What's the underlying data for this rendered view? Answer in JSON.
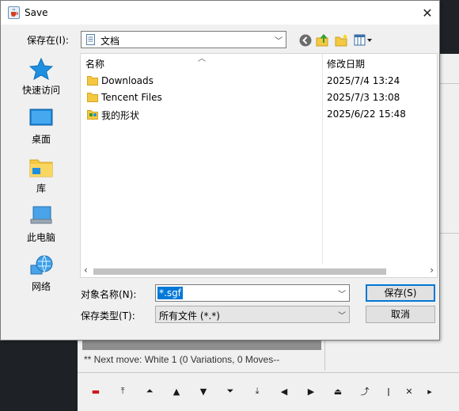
{
  "background_app": {
    "status_text": "** Next move: White 1 (0 Variations, 0 Moves--",
    "nav_buttons": [
      {
        "name": "toggle-icon",
        "glyph": "▬"
      },
      {
        "name": "goto-start-icon",
        "glyph": "⤒"
      },
      {
        "name": "fast-back-variation-icon",
        "glyph": "⏶"
      },
      {
        "name": "back-variation-icon",
        "glyph": "▲"
      },
      {
        "name": "next-variation-icon",
        "glyph": "▼"
      },
      {
        "name": "fast-next-variation-icon",
        "glyph": "⏷"
      },
      {
        "name": "goto-end-variation-icon",
        "glyph": "⤓"
      },
      {
        "name": "prev-move-icon",
        "glyph": "◀"
      },
      {
        "name": "next-move-icon",
        "glyph": "▶"
      },
      {
        "name": "goto-main-icon",
        "glyph": "⏏"
      },
      {
        "name": "goto-line-icon",
        "glyph": "⤴"
      },
      {
        "name": "marker-icon",
        "glyph": "ǀ"
      },
      {
        "name": "delete-icon",
        "glyph": "✕"
      },
      {
        "name": "more-icon",
        "glyph": "▸"
      }
    ]
  },
  "dialog": {
    "title": "Save",
    "look_in_label": "保存在(I):",
    "look_in_value": "文档",
    "places": [
      {
        "key": "quick",
        "label": "快速访问"
      },
      {
        "key": "desktop",
        "label": "桌面"
      },
      {
        "key": "library",
        "label": "库"
      },
      {
        "key": "computer",
        "label": "此电脑"
      },
      {
        "key": "network",
        "label": "网络"
      }
    ],
    "columns": {
      "name": "名称",
      "date": "修改日期"
    },
    "files": [
      {
        "name": "Downloads",
        "date": "2025/7/4 13:24",
        "type": "folder"
      },
      {
        "name": "Tencent Files",
        "date": "2025/7/3 13:08",
        "type": "folder"
      },
      {
        "name": "我的形状",
        "date": "2025/6/22 15:48",
        "type": "special-folder"
      }
    ],
    "file_name_label": "对象名称(N):",
    "file_name_value": "*.sgf",
    "file_type_label": "保存类型(T):",
    "file_type_value": "所有文件 (*.*)",
    "save_button": "保存(S)",
    "cancel_button": "取消"
  },
  "colors": {
    "selection": "#0078d7",
    "folder": "#f5c842",
    "dialog_bg": "#f0f0f0"
  }
}
